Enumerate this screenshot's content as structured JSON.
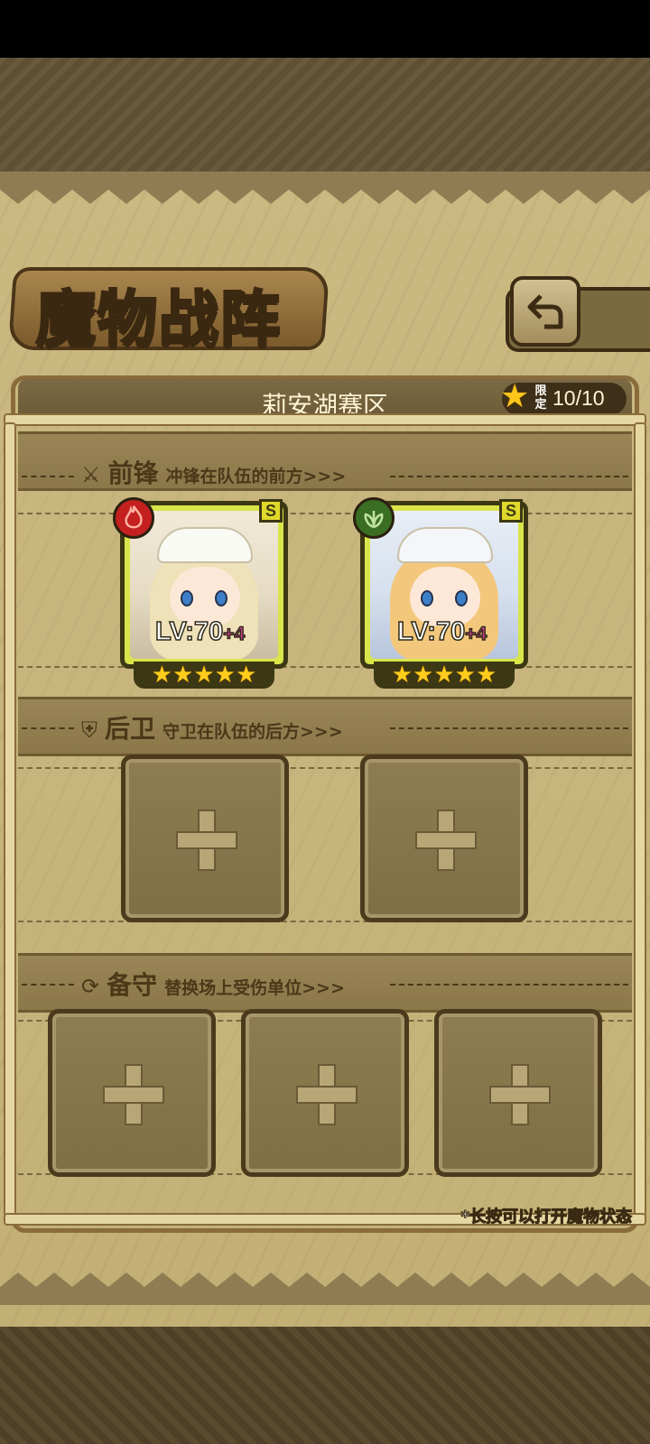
{
  "page": {
    "title": "魔物战阵",
    "region_name": "莉安湖赛区",
    "limit_label": "限定",
    "limit_count": "10/10",
    "hint": "*长按可以打开魔物状态"
  },
  "sections": {
    "front": {
      "icon": "sword-icon",
      "name": "前锋",
      "desc": "冲锋在队伍的前方>>>"
    },
    "back": {
      "icon": "shield-icon",
      "name": "后卫",
      "desc": "守卫在队伍的后方>>>"
    },
    "reserve": {
      "icon": "swap-icon",
      "name": "备守",
      "desc": "替换场上受伤单位>>>"
    }
  },
  "front_units": [
    {
      "element": "fire",
      "element_color": "#c42020",
      "rank": "S",
      "level": "LV:70",
      "level_bonus": "+4",
      "stars": 5
    },
    {
      "element": "grass",
      "element_color": "#3a6e22",
      "rank": "S",
      "level": "LV:70",
      "level_bonus": "+4",
      "stars": 5
    }
  ],
  "colors": {
    "paper": "#c6b47b",
    "card_frame": "#d9e54a",
    "star": "#ffcc1c",
    "level_bonus": "#e2409a"
  }
}
